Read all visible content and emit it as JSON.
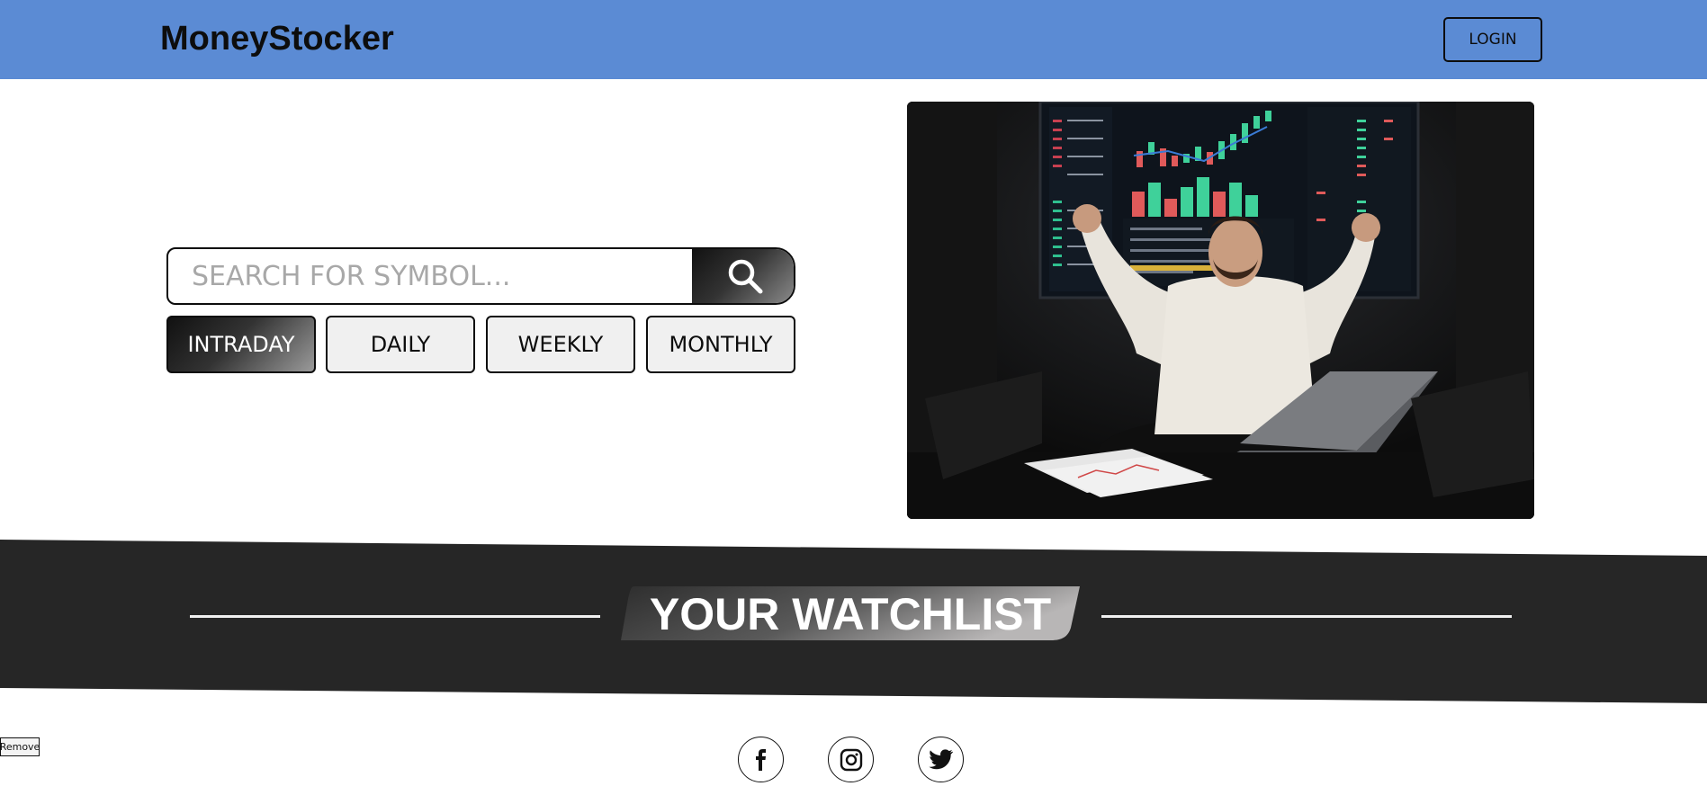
{
  "header": {
    "brand": "MoneyStocker",
    "login_label": "LOGIN",
    "background": "#5b8bd4"
  },
  "search": {
    "placeholder": "SEARCH FOR SYMBOL...",
    "value": "",
    "button_icon": "search-icon"
  },
  "timeframes": {
    "items": [
      {
        "label": "INTRADAY",
        "active": true
      },
      {
        "label": "DAILY",
        "active": false
      },
      {
        "label": "WEEKLY",
        "active": false
      },
      {
        "label": "MONTHLY",
        "active": false
      }
    ]
  },
  "hero": {
    "image": "hero-photo"
  },
  "watchlist": {
    "title": "YOUR WATCHLIST",
    "band_color": "#262626"
  },
  "remove_label": "Remove",
  "social": {
    "items": [
      {
        "icon": "facebook-icon"
      },
      {
        "icon": "instagram-icon"
      },
      {
        "icon": "twitter-icon"
      }
    ]
  }
}
